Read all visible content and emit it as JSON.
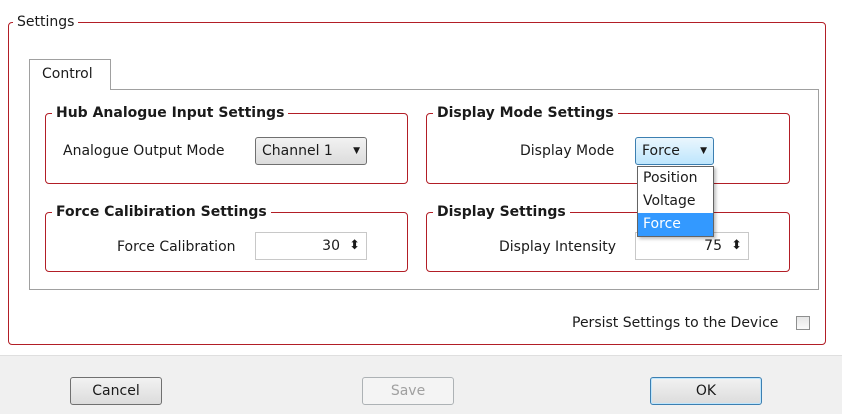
{
  "settings_group": {
    "title": "Settings"
  },
  "tab": {
    "label": "Control"
  },
  "hub_group": {
    "title": "Hub Analogue Input Settings",
    "field_label": "Analogue Output Mode",
    "combo_value": "Channel 1"
  },
  "display_mode_group": {
    "title": "Display Mode Settings",
    "field_label": "Display Mode",
    "combo_value": "Force",
    "options": [
      "Position",
      "Voltage",
      "Force"
    ],
    "selected_option": "Force"
  },
  "force_group": {
    "title": "Force Calibiration Settings",
    "field_label": "Force Calibration",
    "value": "30"
  },
  "display_group": {
    "title": "Display Settings",
    "field_label": "Display Intensity",
    "value": "75"
  },
  "persist": {
    "label": "Persist Settings to the Device",
    "checked": false
  },
  "buttons": {
    "cancel": "Cancel",
    "save": "Save",
    "ok": "OK"
  },
  "icons": {
    "dropdown_arrow": "▼",
    "spinner": "⬍"
  },
  "colors": {
    "group_border": "#b21e26",
    "selection": "#3399ff"
  }
}
